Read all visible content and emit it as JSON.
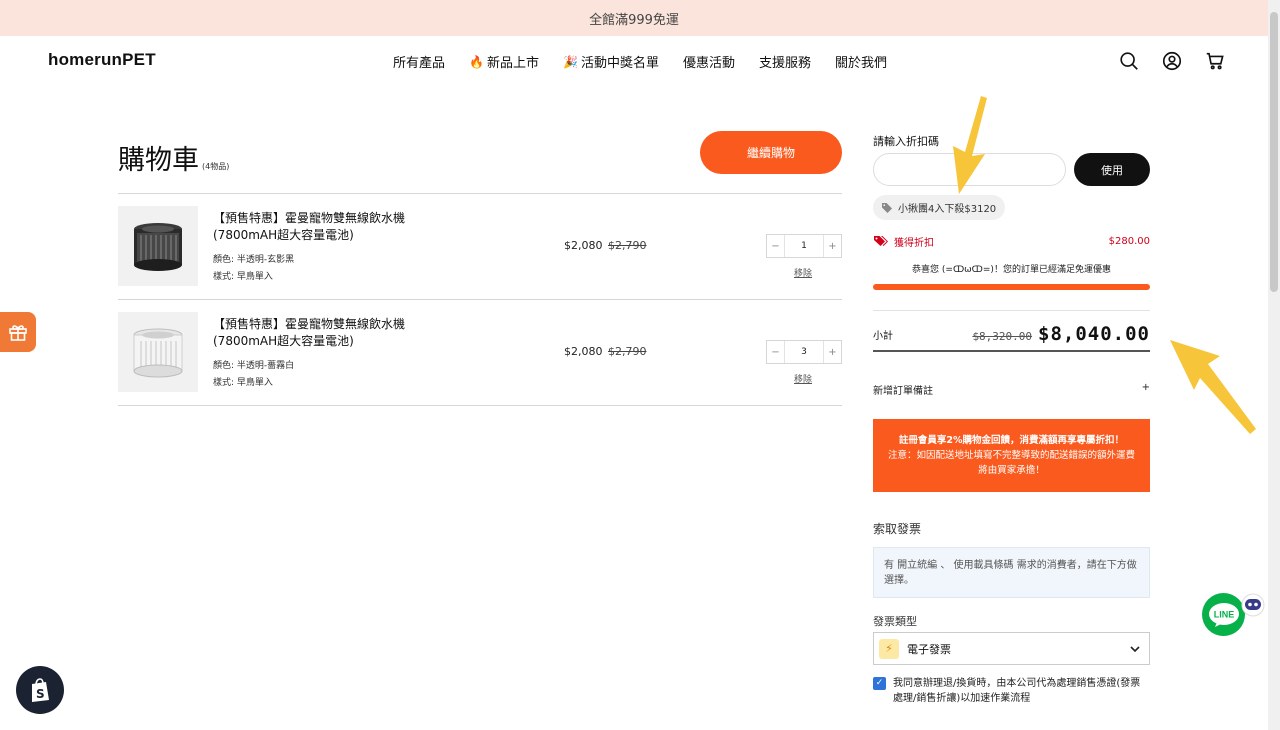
{
  "announcement": "全館滿999免運",
  "header": {
    "logo": "homerunPET",
    "nav": [
      "所有產品",
      "新品上市",
      "活動中獎名單",
      "優惠活動",
      "支援服務",
      "關於我們"
    ],
    "icons": [
      "search-icon",
      "account-icon",
      "cart-icon"
    ]
  },
  "cart": {
    "title": "購物車",
    "count": "(4物品)",
    "continue_label": "繼續購物",
    "items": [
      {
        "name_line1": "【預售特惠】霍曼寵物雙無線飲水機",
        "name_line2": "(7800mAH超大容量電池)",
        "color": "顏色: 半透明-玄影黑",
        "style": "樣式: 早鳥單入",
        "price": "$2,080",
        "old_price": "$2,790",
        "qty": "1",
        "remove": "移除"
      },
      {
        "name_line1": "【預售特惠】霍曼寵物雙無線飲水機",
        "name_line2": "(7800mAH超大容量電池)",
        "color": "顏色: 半透明-薔霧白",
        "style": "樣式: 早鳥單入",
        "price": "$2,080",
        "old_price": "$2,790",
        "qty": "3",
        "remove": "移除"
      }
    ]
  },
  "summary": {
    "coupon_label": "請輸入折扣碼",
    "coupon_placeholder": "",
    "apply_label": "使用",
    "coupon_tag": "小揪團4入下殺$3120",
    "discount_label": "獲得折扣",
    "discount_value": "$280.00",
    "congrats": "恭喜您 (=ↀωↀ=)！您的訂單已經滿足免運優惠",
    "progress": 1.0,
    "subtotal_label": "小計",
    "subtotal_old": "$8,320.00",
    "subtotal_new": "$8,040.00",
    "note_label": "新增訂單備註",
    "note_toggle": "+",
    "promo_line1": "註冊會員享2%購物金回饋，消費滿額再享專屬折扣！",
    "promo_line2": "注意：如因配送地址填寫不完整導致的配送錯誤的額外運費將由買家承擔！",
    "invoice_title": "索取發票",
    "invoice_info": "有 開立統編 、 使用載具條碼 需求的消費者，請在下方做選擇。",
    "invoice_type_label": "發票類型",
    "invoice_type_value": "電子發票",
    "agree_text": "我同意辦理退/換貨時，由本公司代為處理銷售憑證(發票處理/銷售折讓)以加速作業流程"
  },
  "floating": {
    "line_label": "LINE"
  },
  "colors": {
    "accent": "#fa5a1e",
    "announce_bg": "#fbe4dc",
    "discount_red": "#d0021b",
    "line_green": "#06b14a",
    "arrow_yellow": "#f7c53a"
  }
}
